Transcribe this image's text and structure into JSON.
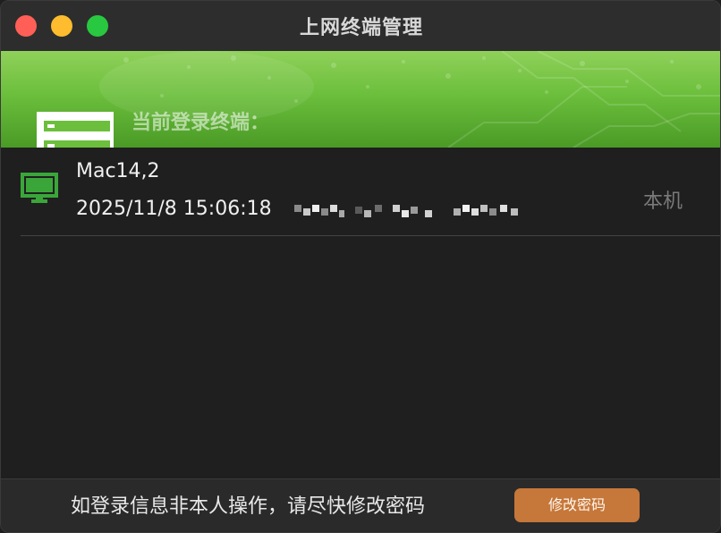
{
  "window": {
    "title": "上网终端管理"
  },
  "banner": {
    "label": "当前登录终端："
  },
  "terminals": [
    {
      "device_name": "Mac14,2",
      "login_time": "2025/11/8 15:06:18",
      "status": "本机"
    }
  ],
  "footer": {
    "notice": "如登录信息非本人操作，请尽快修改密码",
    "button_label": "修改密码"
  },
  "colors": {
    "accent_green": "#6cbf3c",
    "button_orange": "#c6773a",
    "icon_green": "#3aa63a"
  },
  "icons": {
    "server": "server-icon",
    "monitor": "monitor-icon"
  }
}
